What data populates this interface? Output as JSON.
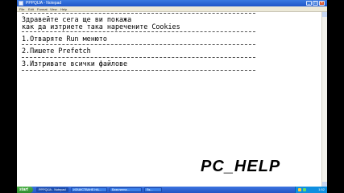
{
  "window": {
    "title": "PPPQIJA - Notepad",
    "min_symbol": "_",
    "max_symbol": "□",
    "close_symbol": "×"
  },
  "menu": {
    "items": [
      "File",
      "Edit",
      "Format",
      "View",
      "Help"
    ]
  },
  "document": {
    "lines": [
      "Здравейте сега ще ви покажа",
      "как да изтриете така наречените Cookies",
      "1.Отваряте Run менюто",
      "2.Пишете Prefetch",
      "3.Изтривате всички файлове"
    ]
  },
  "watermark": {
    "text": "PC_HELP"
  },
  "taskbar": {
    "start_label": "start",
    "tasks": [
      "PPPQIJA - Notepad",
      "ИЗЧИСТВАНЕ НА...",
      "Безплатна...",
      "Ss..."
    ],
    "clock": "1:52"
  },
  "colors": {
    "titlebar": "#1f56c8",
    "taskbar": "#2456c4",
    "start": "#3b9a38"
  }
}
